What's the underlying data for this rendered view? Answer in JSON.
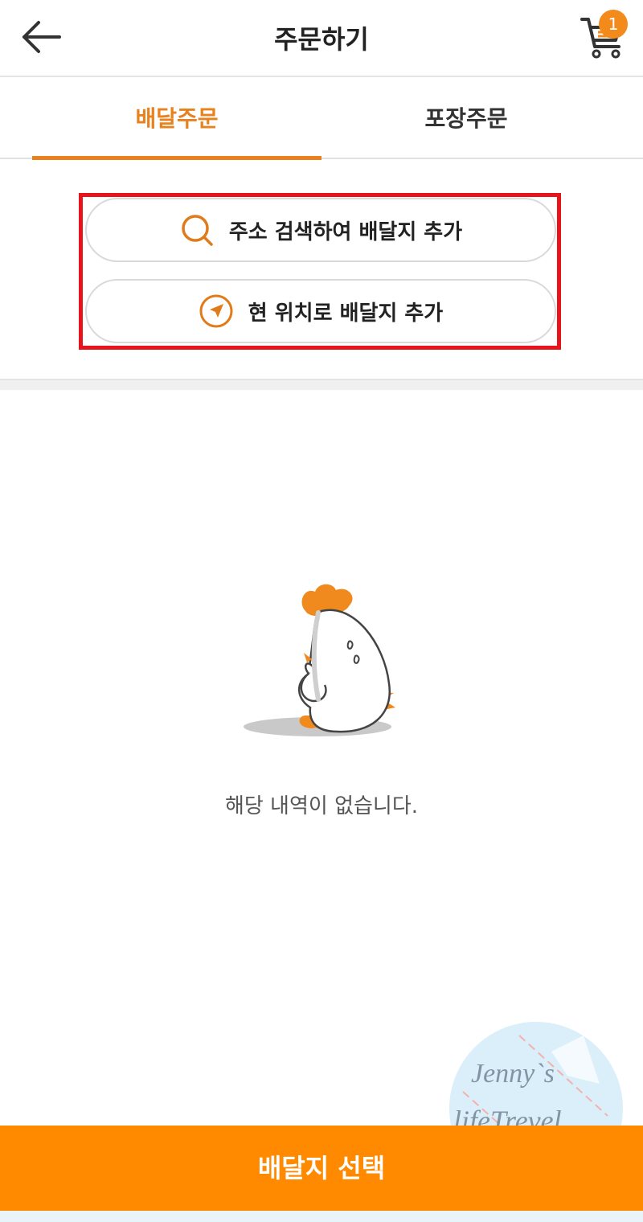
{
  "header": {
    "title": "주문하기",
    "back_icon": "arrow-left-icon",
    "cart_icon": "cart-icon",
    "cart_count": "1"
  },
  "tabs": [
    {
      "label": "배달주문",
      "active": true
    },
    {
      "label": "포장주문",
      "active": false
    }
  ],
  "address_actions": {
    "search": {
      "label": "주소 검색하여 배달지 추가",
      "icon": "search-icon"
    },
    "current_location": {
      "label": "현 위치로 배달지 추가",
      "icon": "location-arrow-icon"
    }
  },
  "empty_state": {
    "message": "해당 내역이 없습니다.",
    "illustration": "sad-chicken-mascot"
  },
  "watermark": {
    "line1": "Jenny`s",
    "line2": "lifeTrevel"
  },
  "footer": {
    "cta_label": "배달지 선택"
  },
  "colors": {
    "accent": "#e8821e",
    "cta": "#ff8a00",
    "highlight": "#e8141b",
    "badge": "#f28a1c"
  }
}
